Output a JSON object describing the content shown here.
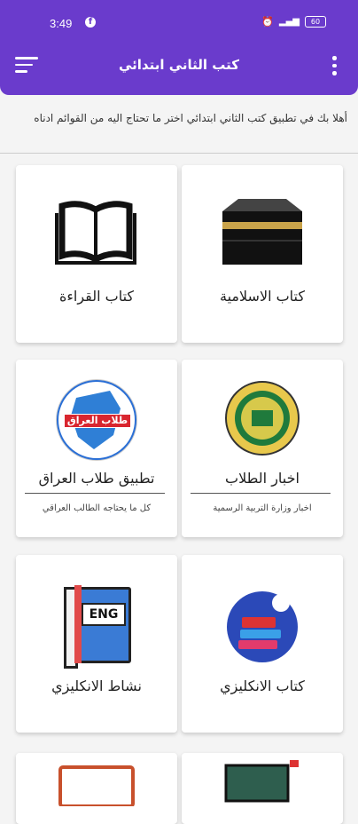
{
  "status_bar": {
    "time": "3:49",
    "battery": "60"
  },
  "header": {
    "title": "كتب الثاني ابتدائي"
  },
  "intro_text": "أهلا بك في تطبيق كتب الثاني ابتدائي اختر ما تحتاج اليه من القوائم ادناه",
  "cards": [
    {
      "title": "كتاب الاسلامية",
      "icon": "kaaba-icon"
    },
    {
      "title": "كتاب القراءة",
      "icon": "open-book-icon"
    },
    {
      "title": "اخبار الطلاب",
      "subtitle": "اخبار وزارة التربية الرسمية",
      "icon": "ministry-logo-icon"
    },
    {
      "title": "تطبيق طلاب العراق",
      "subtitle": "كل ما يحتاجه الطالب العراقي",
      "icon": "iraq-students-logo-icon",
      "logo_text": "طلاب العراق"
    },
    {
      "title": "كتاب الانكليزي",
      "icon": "english-books-icon"
    },
    {
      "title": "نشاط الانكليزي",
      "icon": "eng-book-icon",
      "logo_text": "ENG"
    }
  ]
}
